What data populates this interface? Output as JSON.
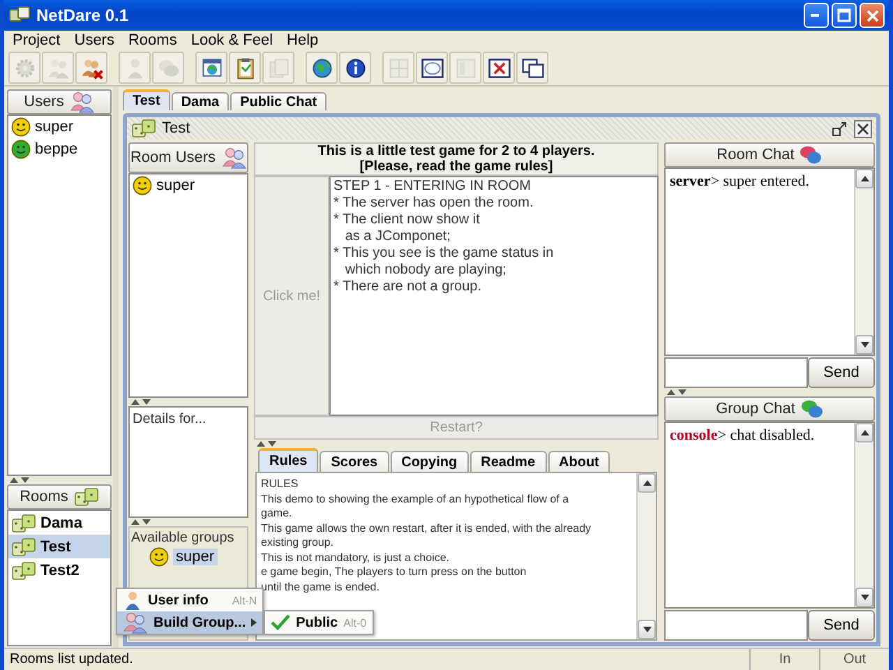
{
  "window": {
    "title": "NetDare 0.1"
  },
  "menu": [
    "Project",
    "Users",
    "Rooms",
    "Look & Feel",
    "Help"
  ],
  "toolbar": [
    [
      {
        "kind": "gear",
        "disabled": true
      },
      {
        "kind": "people",
        "disabled": true
      },
      {
        "kind": "people-remove",
        "disabled": false
      }
    ],
    [
      {
        "kind": "person",
        "disabled": true
      },
      {
        "kind": "chat",
        "disabled": true
      }
    ],
    [
      {
        "kind": "globe-window",
        "disabled": false
      },
      {
        "kind": "clipboard",
        "disabled": false
      },
      {
        "kind": "pages",
        "disabled": true
      }
    ],
    [
      {
        "kind": "globe",
        "disabled": false
      },
      {
        "kind": "info",
        "disabled": false
      }
    ],
    [
      {
        "kind": "grid",
        "disabled": true
      },
      {
        "kind": "window",
        "disabled": false
      },
      {
        "kind": "panel",
        "disabled": true
      },
      {
        "kind": "close-window",
        "disabled": false
      },
      {
        "kind": "windows",
        "disabled": false
      }
    ]
  ],
  "users": {
    "title": "Users",
    "items": [
      {
        "name": "super",
        "color": "#f2d000"
      },
      {
        "name": "beppe",
        "color": "#2fae2f"
      }
    ]
  },
  "rooms": {
    "title": "Rooms",
    "items": [
      {
        "name": "Dama",
        "selected": false
      },
      {
        "name": "Test",
        "selected": true
      },
      {
        "name": "Test2",
        "selected": false
      }
    ]
  },
  "tabs": [
    {
      "label": "Test",
      "selected": true
    },
    {
      "label": "Dama",
      "selected": false
    },
    {
      "label": "Public Chat",
      "selected": false
    }
  ],
  "frame": {
    "title": "Test",
    "room_users": {
      "title": "Room Users",
      "items": [
        {
          "name": "super",
          "color": "#f2d000"
        }
      ]
    },
    "details": "Details for...",
    "groups": {
      "title": "Available groups",
      "items": [
        {
          "name": "super",
          "color": "#f2d000",
          "selected": true
        }
      ]
    },
    "game": {
      "heading": [
        "This is a little test game for 2 to 4 players.",
        "[Please, read the game rules]"
      ],
      "click_button": {
        "label": "Click me!",
        "disabled": true
      },
      "status_lines": [
        "STEP 1 - ENTERING IN ROOM",
        "* The server has open the room.",
        "* The client now show it",
        "   as a JComponet;",
        "* This you see is the game status in",
        "   which nobody are playing;",
        "* There are not a group."
      ],
      "restart_button": {
        "label": "Restart?",
        "disabled": true
      }
    },
    "rules_tabs": [
      {
        "label": "Rules",
        "selected": true
      },
      {
        "label": "Scores",
        "selected": false
      },
      {
        "label": "Copying",
        "selected": false
      },
      {
        "label": "Readme",
        "selected": false
      },
      {
        "label": "About",
        "selected": false
      }
    ],
    "rules_lines": [
      "RULES",
      "This demo to showing the example of an hypothetical flow of a",
      "game.",
      "This game allows the own restart, after it is ended, with the already",
      "existing group.",
      "This is not mandatory, is just a choice.",
      "e game begin, The players to turn press on the button",
      "until the game is ended."
    ],
    "room_chat": {
      "title": "Room Chat",
      "messages": [
        {
          "sender": "server",
          "text": "> super entered.",
          "color": "#000000"
        }
      ],
      "send": "Send"
    },
    "group_chat": {
      "title": "Group Chat",
      "messages": [
        {
          "sender": "console",
          "text": "> chat disabled.",
          "color": "#b00020"
        }
      ],
      "send": "Send"
    }
  },
  "popup": {
    "items": [
      {
        "label": "User info",
        "shortcut": "Alt-N",
        "kind": "item",
        "selected": false
      },
      {
        "label": "Build Group...",
        "kind": "submenu",
        "selected": true
      }
    ],
    "submenu": [
      {
        "label": "Public",
        "shortcut": "Alt-0",
        "checked": true
      }
    ]
  },
  "status": {
    "message": "Rooms list updated.",
    "in": "In",
    "out": "Out"
  }
}
